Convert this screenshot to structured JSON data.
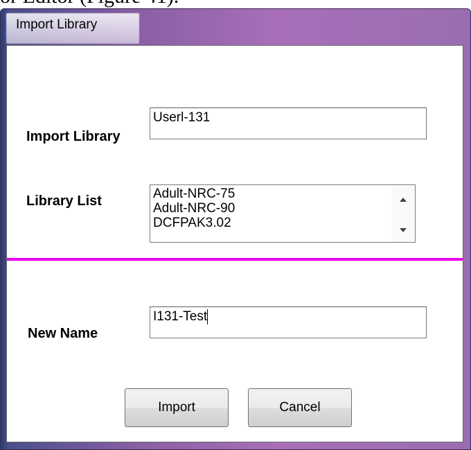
{
  "background_text": "or Editor (Figure 41).",
  "window": {
    "title": "Import Library"
  },
  "form": {
    "import_library": {
      "label": "Import Library",
      "value": "Userl-131"
    },
    "library_list": {
      "label": "Library List",
      "items": [
        "Adult-NRC-75",
        "Adult-NRC-90",
        "DCFPAK3.02"
      ]
    },
    "new_name": {
      "label": "New Name",
      "value": "I131-Test"
    }
  },
  "buttons": {
    "import_label": "Import",
    "cancel_label": "Cancel"
  },
  "colors": {
    "separator": "#ee00ee",
    "title_bar_gradient_end": "#a86fb8"
  }
}
